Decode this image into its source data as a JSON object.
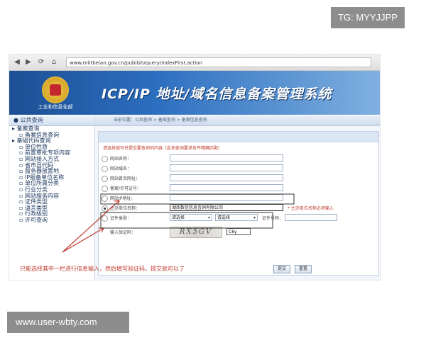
{
  "watermarks": {
    "top": "TG: MYYJJPP",
    "bottom": "www.user-wbty.com"
  },
  "browser": {
    "url": "www.miitbeian.gov.cn/publish/query/indexFirst.action"
  },
  "banner": {
    "title": "ICP/IP 地址/域名信息备案管理系统",
    "ministry": "工业和信息化部"
  },
  "sidebar": {
    "header": "公共查询",
    "items": [
      {
        "label": "备案查询",
        "level": 1
      },
      {
        "label": "备案信息查询",
        "level": 2
      },
      {
        "label": "基础代码查询",
        "level": 1
      },
      {
        "label": "单位性质",
        "level": 2
      },
      {
        "label": "前置审批专项内容",
        "level": 2
      },
      {
        "label": "网站接入方式",
        "level": 2
      },
      {
        "label": "省市县代码",
        "level": 2
      },
      {
        "label": "服务器放置地",
        "level": 2
      },
      {
        "label": "IP报备单位名称",
        "level": 2
      },
      {
        "label": "单位所属分类",
        "level": 2
      },
      {
        "label": "行业分类",
        "level": 2
      },
      {
        "label": "网站服务内容",
        "level": 2
      },
      {
        "label": "证件类型",
        "level": 2
      },
      {
        "label": "语言类型",
        "level": 2
      },
      {
        "label": "行政级别",
        "level": 2
      },
      {
        "label": "许可查询",
        "level": 2
      }
    ]
  },
  "main": {
    "breadcrumb": "当前位置：公共查询 > 备案查询 > 备案信息查询",
    "hint": "请选择填写并提交要查询的内容（此项查询要求条件精确匹配）",
    "fields": [
      {
        "label": "网站名称：",
        "value": "",
        "selected": false
      },
      {
        "label": "网站域名：",
        "value": "",
        "selected": false
      },
      {
        "label": "网站首页网址：",
        "value": "",
        "selected": false
      },
      {
        "label": "备案/许可证号：",
        "value": "",
        "selected": false
      },
      {
        "label": "网站IP地址：",
        "value": "",
        "selected": false
      },
      {
        "label": "主办单位名称：",
        "value": "湖南数信信息咨询有限公司",
        "selected": true,
        "note": "* 主办单位名称必须输入"
      }
    ],
    "cert": {
      "label": "证件类型：",
      "select1": "请选择",
      "select2": "请选择",
      "number_label": "证件号码："
    },
    "captcha": {
      "label": "输入验证码：",
      "image_text": "RX5GV",
      "input_value": "C6y"
    },
    "buttons": {
      "submit": "提交",
      "reset": "重置"
    }
  },
  "annotation": "只能选择其中一栏进行信息输入，然后填写验证码，提交就可以了"
}
